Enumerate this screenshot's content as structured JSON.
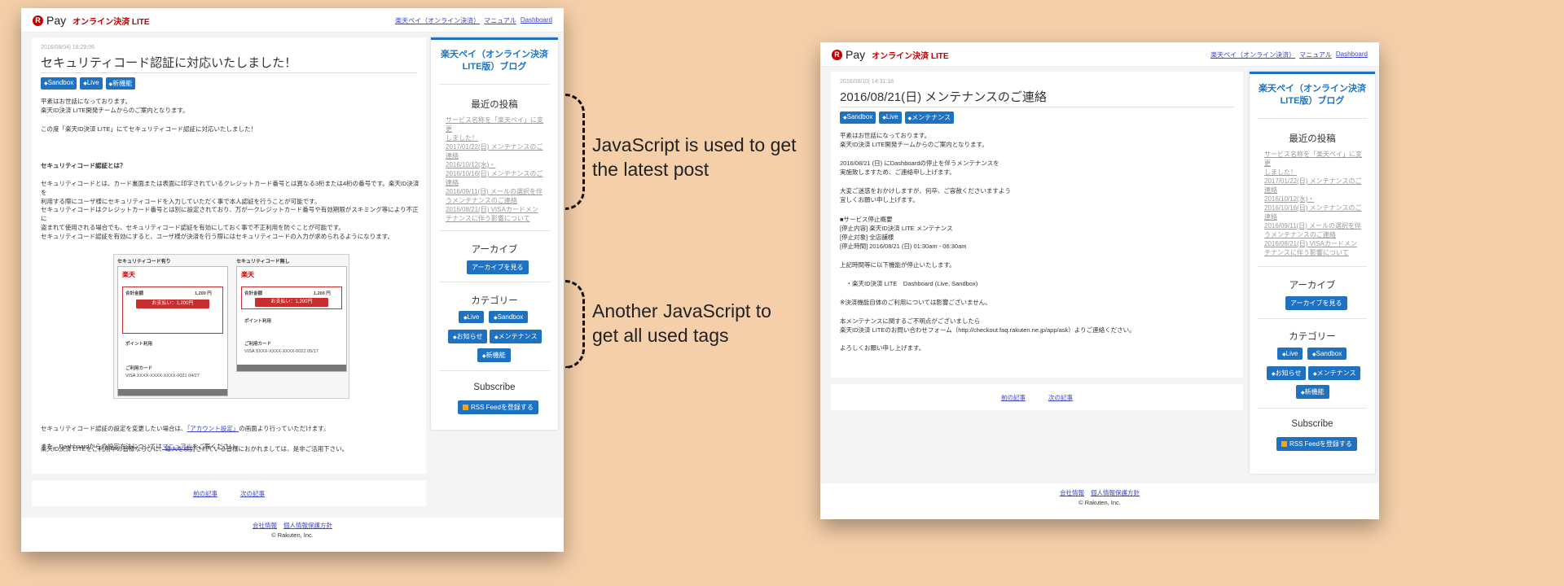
{
  "site": {
    "logo_mark": "R",
    "logo_pay": "Pay",
    "logo_lite": "オンライン決済 LITE",
    "nav": [
      "楽天ペイ（オンライン決済）",
      "マニュアル",
      "Dashboard"
    ]
  },
  "left": {
    "meta": "2016/08/04| 18:29:06",
    "title": "セキュリティコード認証に対応いたしました！",
    "tags": [
      "Sandbox",
      "Live",
      "新機能"
    ],
    "paragraphs": [
      "平素はお世話になっております。\n楽天ID決済 LITE開発チームからのご案内となります。",
      "この度「楽天ID決済 LITE」にてセキュリティコード認証に対応いたしました！",
      "セキュリティコード認証とは？",
      "セキュリティコードとは、カード裏面または表面に印字されているクレジットカード番号とは異なる3桁または4桁の番号です。楽天ID決済を\n利用する際にユーザ様にセキュリティコードを入力していただく事で本人認証を行うことが可能です。",
      "セキュリティコードはクレジットカード番号とは別に設定されており、万が一クレジットカード番号や有効期限がスキミング等により不正に\n盗まれて使用される場合でも、セキュリティコード認証を有効にしておく事で不正利用を防ぐことが可能です。",
      "セキュリティコード認証を有効にすると、ユーザ様が決済を行う際にはセキュリティコードの入力が求められるようになります。"
    ],
    "figure": {
      "left_caption": "セキュリティコード有り",
      "right_caption": "セキュリティコード無し",
      "rakuten": "楽天",
      "total_label": "合計金額",
      "total_value": "1,200 円",
      "pay_button": "お支払い：1,200円",
      "point_label": "ポイント利用",
      "card_label": "ご利用カード",
      "card_left": "VISA XXXX-XXXX-XXXX-0021 04/27",
      "card_right": "VISA XXXX-XXXX-XXXX-0022 05/17"
    },
    "after": [
      "セキュリティコード認証の設定を変更したい場合は、",
      "「アカウント設定」",
      "の画面より行っていただけます。",
      "また、Dashboardからの設定方法については",
      "マニュアル",
      "をご覧ください。",
      "楽天ID決済 LITEをご利用中の皆様ならびに、導入を検討されている皆様におかれましては、是非ご活用下さい。"
    ],
    "pager": [
      "前の記事",
      "次の記事"
    ]
  },
  "right": {
    "meta": "2016/08/10| 14:31:18",
    "title": "2016/08/21(日) メンテナンスのご連絡",
    "tags": [
      "Sandbox",
      "Live",
      "メンテナンス"
    ],
    "paragraphs": [
      "平素はお世話になっております。\n楽天ID決済 LITE開発チームからのご案内となります。",
      "2016/08/21 (日) にDashboardの停止を伴うメンテナンスを\n実施致しますため、ご連絡申し上げます。",
      "大変ご迷惑をおかけしますが、何卒、ご容赦くださいますよう\n宜しくお願い申し上げます。",
      "■サービス停止概要\n[停止内容] 楽天ID決済 LITE メンテナンス\n[停止対象] 全店舗様\n[停止時間] 2016/08/21 (日) 01:30am - 06:30am",
      "上記時間等に以下機能が停止いたします。",
      "　・楽天ID決済 LITE　Dashboard (Live, Sandbox)",
      "※決済機能自体のご利用については影響ございません。",
      "本メンテナンスに関するご不明点がございましたら\n楽天ID決済 LITEのお問い合わせフォーム（http://checkout.faq.rakuten.ne.jp/app/ask）よりご連絡ください。",
      "よろしくお願い申し上げます。"
    ],
    "pager": [
      "前の記事",
      "次の記事"
    ]
  },
  "sidebar": {
    "blog_title": "楽天ペイ（オンライン決済\nLITE版）ブログ",
    "recent_heading": "最近の投稿",
    "recent_posts": [
      "サービス名称を「楽天ペイ」に変更",
      "しました！",
      "2017/01/22(日) メンテナンスのご",
      "連絡",
      "2016/10/12(水)・",
      "2016/10/16(日) メンテナンスのご",
      "連絡",
      "2016/09/11(日) メールの選択を伴",
      "うメンテナンスのご連絡",
      "2016/08/21(日) VISAカードメン",
      "テナンスに伴う影響について"
    ],
    "archive_heading": "アーカイブ",
    "archive_button": "アーカイブを見る",
    "category_heading": "カテゴリー",
    "categories": [
      "Live",
      "Sandbox",
      "お知らせ",
      "メンテナンス",
      "新機能"
    ],
    "subscribe_heading": "Subscribe",
    "rss_button": "RSS Feedを登録する"
  },
  "footer": {
    "links": [
      "会社情報",
      "個人情報保護方針"
    ],
    "copyright": "© Rakuten, Inc."
  },
  "annotations": {
    "latest_post": "JavaScript is used to get\nthe latest post",
    "used_tags": "Another JavaScript to\nget all used tags"
  }
}
